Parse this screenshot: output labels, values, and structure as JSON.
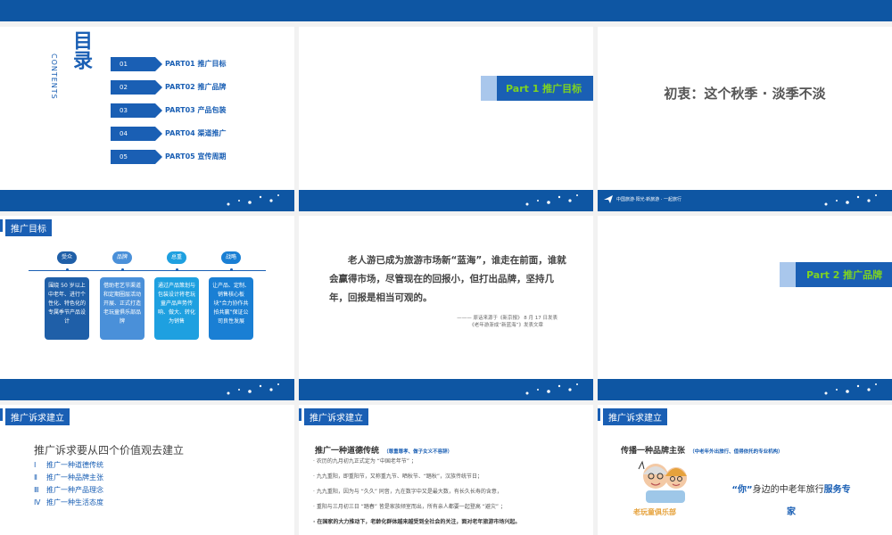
{
  "s1": {
    "title": "目录",
    "subtitle": "CONTENTS",
    "items": [
      {
        "num": "01",
        "label": "PART01  推广目标"
      },
      {
        "num": "02",
        "label": "PART02  推广品牌"
      },
      {
        "num": "03",
        "label": "PART03  产品包装"
      },
      {
        "num": "04",
        "label": "PART04  渠道推广"
      },
      {
        "num": "05",
        "label": "PART05  宣传周期"
      }
    ]
  },
  "s2": {
    "part_label": "Part 1  推广目标"
  },
  "s3": {
    "heading": "初衷：这个秋季 · 淡季不淡",
    "logo_text": "中国旅游·阳光·新旅游 · 一起旅行"
  },
  "s4": {
    "tag": "推广目标",
    "nodes": [
      {
        "label": "受众",
        "text": "围绕 50 岁以上中老年、进行个性化、特色化的专属季节产品设计"
      },
      {
        "label": "品牌",
        "text": "借助老艺节渠道和定期圈层活动开展、正式打造老玩童俱乐部品牌"
      },
      {
        "label": "总重",
        "text": "通过产品策划与包装设计将老玩童产品声势传响、做大、转化为销售"
      },
      {
        "label": "战略",
        "text": "让产品、定制、销售核心板块“合力协作共拍共赢”保证公司良性发展"
      }
    ],
    "colors": [
      "#1f5fa8",
      "#4a90d9",
      "#1ea0e0",
      "#1a7fd4"
    ]
  },
  "s5": {
    "quote": "老人游已成为旅游市场新“蓝海”，谁走在前面，谁就会赢得市场，尽管现在的回报小，但打出品牌，坚持几年，回报是相当可观的。",
    "source_line1": "——— 原话来源于《新京报》 8 月 17 日发表",
    "source_line2": "《老年游渐成“新蓝海”》发表文章"
  },
  "s6": {
    "part_label": "Part 2  推广品牌"
  },
  "s7": {
    "tag": "推广诉求建立",
    "heading": "推广诉求要从四个价值观去建立",
    "items": [
      {
        "num": "Ⅰ",
        "text": "推广一种道德传统"
      },
      {
        "num": "Ⅱ",
        "text": "推广一种品牌主张"
      },
      {
        "num": "Ⅲ",
        "text": "推广一种产品理念"
      },
      {
        "num": "Ⅳ",
        "text": "推广一种生活态度"
      }
    ]
  },
  "s8": {
    "tag": "推广诉求建立",
    "heading": "推广一种道德传统",
    "heading_note": "（尊重尊孝、做子女义不容辞）",
    "lines": [
      "· 农历的九月初九正式定为 “中国老年节” ；",
      "· 九九重阳，即重阳节，又称重九节、晒秋节、“踏秋”，汉族传统节日；",
      "· 九九重阳，因为与 “久久” 同音，九在数字中又是最大数，有长久长寿的含意，",
      "· 重阳与三月初三日 “踏春” 皆是家族倾室而出，所有亲人都要一起登高 “避灾” ；",
      "· 在国家的大力推动下，老龄化群体越来越受到全社会的关注，面对老年旅游市场兴起。"
    ]
  },
  "s9": {
    "tag": "推广诉求建立",
    "heading": "传播一种品牌主张",
    "heading_note": "（中老年外出旅行、值得依托的专业机构）",
    "quote_prefix": "“你”",
    "quote_mid": "身边的中老年旅行",
    "quote_strong": "服务专",
    "quote_end": "家",
    "logo_text": "老玩童俱乐部"
  }
}
